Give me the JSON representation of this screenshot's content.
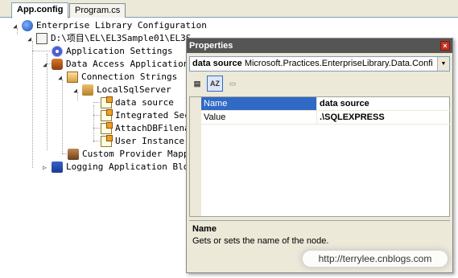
{
  "tabs": [
    {
      "label": "App.config",
      "active": true
    },
    {
      "label": "Program.cs",
      "active": false
    }
  ],
  "tree": {
    "root": "Enterprise Library Configuration",
    "file": "D:\\项目\\EL\\EL3Sample01\\EL3S",
    "app_settings": "Application Settings",
    "data_access": "Data Access Application",
    "conn_strings": "Connection Strings",
    "local_sql": "LocalSqlServer",
    "data_source": "data source",
    "integrated_security": "Integrated Secu",
    "attach_db": "AttachDBFilenam",
    "user_instance": "User Instance",
    "custom_provider": "Custom Provider Mappi",
    "logging": "Logging Application Bloc"
  },
  "properties": {
    "title": "Properties",
    "close_glyph": "×",
    "selector_name": "data source",
    "selector_type": "Microsoft.Practices.EnterpriseLibrary.Data.Confi",
    "dropdown_glyph": "▼",
    "toolbar": {
      "categorized": "▤",
      "alphabetical": "AZ",
      "pages": "▭"
    },
    "rows": [
      {
        "key": "Name",
        "value": "data source",
        "selected": true
      },
      {
        "key": "Value",
        "value": ".\\SQLEXPRESS",
        "selected": false
      }
    ],
    "description_title": "Name",
    "description_text": "Gets or sets the name of the node."
  },
  "watermark": "http://terrylee.cnblogs.com",
  "colors": {
    "selection": "#316ac5",
    "title_bar": "#555555",
    "panel": "#ece9d8"
  }
}
